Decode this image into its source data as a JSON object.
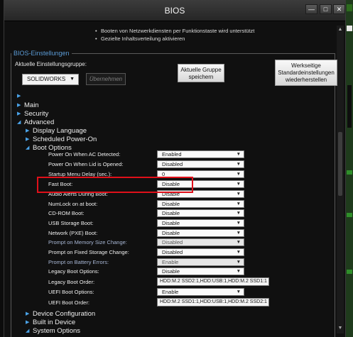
{
  "window": {
    "title": "BIOS",
    "min_icon": "minimize-icon",
    "max_icon": "maximize-icon",
    "close_icon": "close-icon"
  },
  "info_lines": [
    "Booten von Netzwerkdiensten per Funktionstaste wird unterstützt",
    "Gezielte Inhaltsverteilung aktivieren"
  ],
  "settings_group": {
    "title": "BIOS-Einstellungen",
    "group_label": "Aktuelle Einstellungsgruppe:",
    "group_value": "SOLIDWORKS",
    "apply_label": "Übernehmen",
    "save_label_1": "Aktuelle Gruppe",
    "save_label_2": "speichern",
    "reset_label_1": "Werkseitige",
    "reset_label_2": "Standardeinstellungen",
    "reset_label_3": "wiederherstellen"
  },
  "tree": {
    "main": "Main",
    "security": "Security",
    "advanced": "Advanced",
    "display_language": "Display Language",
    "scheduled_power_on": "Scheduled Power-On",
    "boot_options": "Boot Options",
    "device_configuration": "Device Configuration",
    "built_in_device": "Built in Device",
    "system_options": "System Options"
  },
  "boot_settings": [
    {
      "label": "Power On When AC Detected:",
      "value": "Enabled",
      "type": "dropdown",
      "dim": false
    },
    {
      "label": "Power On When Lid is Opened:",
      "value": "Disabled",
      "type": "dropdown",
      "dim": false
    },
    {
      "label": "Startup Menu Delay (sec.):",
      "value": "0",
      "type": "dropdown",
      "dim": false
    },
    {
      "label": "Fast Boot:",
      "value": "Disable",
      "type": "dropdown",
      "dim": false
    },
    {
      "label": "Audio Alerts During Boot:",
      "value": "Disable",
      "type": "dropdown",
      "dim": false
    },
    {
      "label": "NumLock on at boot:",
      "value": "Disable",
      "type": "dropdown",
      "dim": false
    },
    {
      "label": "CD-ROM Boot:",
      "value": "Disable",
      "type": "dropdown",
      "dim": false
    },
    {
      "label": "USB Storage Boot:",
      "value": "Disable",
      "type": "dropdown",
      "dim": false
    },
    {
      "label": "Network (PXE) Boot:",
      "value": "Disable",
      "type": "dropdown",
      "dim": false
    },
    {
      "label": "Prompt on Memory Size Change:",
      "value": "Disabled",
      "type": "dropdown",
      "dim": true
    },
    {
      "label": "Prompt on Fixed Storage Change:",
      "value": "Disabled",
      "type": "dropdown",
      "dim": false
    },
    {
      "label": "Prompt on Battery Errors:",
      "value": "Enable",
      "type": "dropdown",
      "dim": true
    },
    {
      "label": "Legacy Boot Options:",
      "value": "Disable",
      "type": "dropdown",
      "dim": false
    },
    {
      "label": "Legacy Boot Order:",
      "value": "HDD:M.2 SSD2:1,HDD:USB:1,HDD:M.2 SSD1:1",
      "type": "text",
      "dim": false
    },
    {
      "label": "UEFI Boot Options:",
      "value": "Enable",
      "type": "dropdown",
      "dim": false
    },
    {
      "label": "UEFI Boot Order:",
      "value": "HDD:M.2 SSD1:1,HDD:USB:1,HDD:M.2 SSD2:1",
      "type": "text",
      "dim": false
    }
  ],
  "colors": {
    "accent": "#4aa3e8",
    "highlight": "#e0101a",
    "group_title": "#5b9bd5"
  }
}
